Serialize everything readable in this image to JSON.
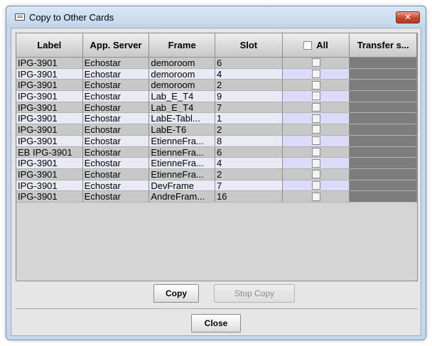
{
  "window": {
    "title": "Copy to Other Cards",
    "close_glyph": "✕"
  },
  "table": {
    "columns": [
      "Label",
      "App. Server",
      "Frame",
      "Slot",
      "All",
      "Transfer s..."
    ],
    "rows": [
      {
        "label": "IPG-3901",
        "server": "Echostar",
        "frame": "demoroom",
        "slot": "6"
      },
      {
        "label": "IPG-3901",
        "server": "Echostar",
        "frame": "demoroom",
        "slot": "4"
      },
      {
        "label": "IPG-3901",
        "server": "Echostar",
        "frame": "demoroom",
        "slot": "2"
      },
      {
        "label": "IPG-3901",
        "server": "Echostar",
        "frame": "Lab_E_T4",
        "slot": "9"
      },
      {
        "label": "IPG-3901",
        "server": "Echostar",
        "frame": "Lab_E_T4",
        "slot": "7"
      },
      {
        "label": "IPG-3901",
        "server": "Echostar",
        "frame": "LabE-Tabl...",
        "slot": "1"
      },
      {
        "label": "IPG-3901",
        "server": "Echostar",
        "frame": "LabE-T6",
        "slot": "2"
      },
      {
        "label": "IPG-3901",
        "server": "Echostar",
        "frame": "EtienneFra...",
        "slot": "8"
      },
      {
        "label": "EB IPG-3901",
        "server": "Echostar",
        "frame": "EtienneFra...",
        "slot": "6"
      },
      {
        "label": "IPG-3901",
        "server": "Echostar",
        "frame": "EtienneFra...",
        "slot": "4"
      },
      {
        "label": "IPG-3901",
        "server": "Echostar",
        "frame": "EtienneFra...",
        "slot": "2"
      },
      {
        "label": "IPG-3901",
        "server": "Echostar",
        "frame": "DevFrame",
        "slot": "7"
      },
      {
        "label": "IPG-3901",
        "server": "Echostar",
        "frame": "AndreFram...",
        "slot": "16"
      }
    ]
  },
  "buttons": {
    "copy": "Copy",
    "stop_copy": "Stop Copy",
    "close": "Close"
  },
  "colors": {
    "transfer_cell": "#7c7c7c",
    "close_button": "#c9452c"
  }
}
